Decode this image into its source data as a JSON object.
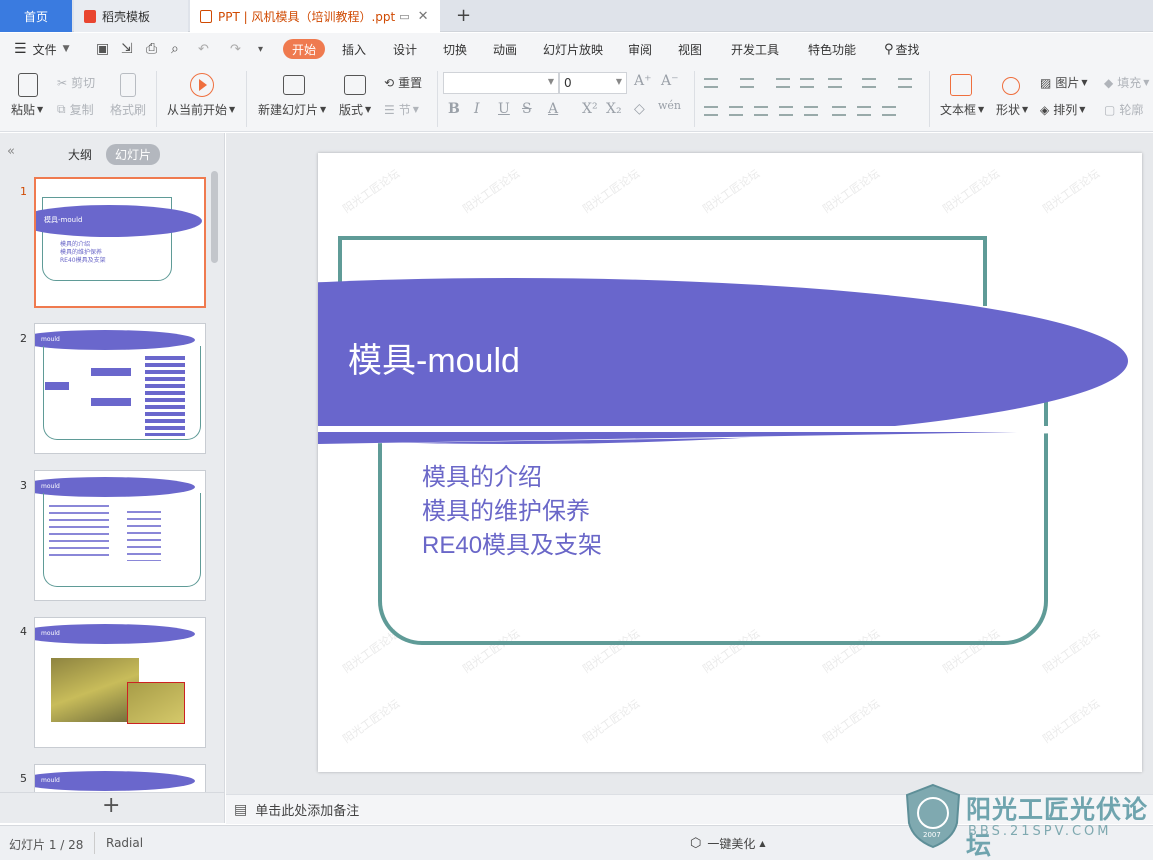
{
  "tabs": [
    {
      "label": "首页"
    },
    {
      "label": "稻壳模板"
    },
    {
      "label": "PPT | 风机模具（培训教程）.ppt"
    }
  ],
  "menu": {
    "file": "文件",
    "items": [
      "开始",
      "插入",
      "设计",
      "切换",
      "动画",
      "幻灯片放映",
      "审阅",
      "视图",
      "开发工具",
      "特色功能"
    ],
    "search": "查找"
  },
  "ribbon": {
    "paste": "粘贴",
    "cut": "剪切",
    "copy": "复制",
    "format_painter": "格式刷",
    "play_from_current": "从当前开始",
    "new_slide": "新建幻灯片",
    "layout": "版式",
    "reset": "重置",
    "section": "节",
    "font_size": "0",
    "textbox": "文本框",
    "shape": "形状",
    "picture": "图片",
    "arrange": "排列",
    "fill": "填充",
    "outline": "轮廓"
  },
  "left_pane": {
    "outline_tab": "大纲",
    "slides_tab": "幻灯片",
    "collapse": "«",
    "add": "+",
    "thumbnails": [
      {
        "num": "1",
        "title": "模具-mould",
        "lines": [
          "模具的介绍",
          "模具的维护保养",
          "RE40模具及支架"
        ]
      },
      {
        "num": "2",
        "title": "mould"
      },
      {
        "num": "3",
        "title": "mould"
      },
      {
        "num": "4",
        "title": "mould"
      },
      {
        "num": "5",
        "title": "mould"
      }
    ]
  },
  "slide": {
    "title": "模具-mould",
    "bullets": [
      "模具的介绍",
      "模具的维护保养",
      "RE40模具及支架"
    ],
    "watermark": "阳光工匠论坛"
  },
  "notes": {
    "placeholder": "单击此处添加备注"
  },
  "status": {
    "slide_counter": "幻灯片 1 / 28",
    "theme": "Radial",
    "beautify": "一键美化"
  },
  "logo": {
    "text": "阳光工匠光伏论坛",
    "url": "BBS.21SPV.COM",
    "year": "2007"
  },
  "colors": {
    "accent": "#ef7a4f",
    "slide_band": "#6966cc",
    "frame": "#5f9b97",
    "bullet_text": "#6a67c8",
    "home_tab": "#3a7be0"
  }
}
